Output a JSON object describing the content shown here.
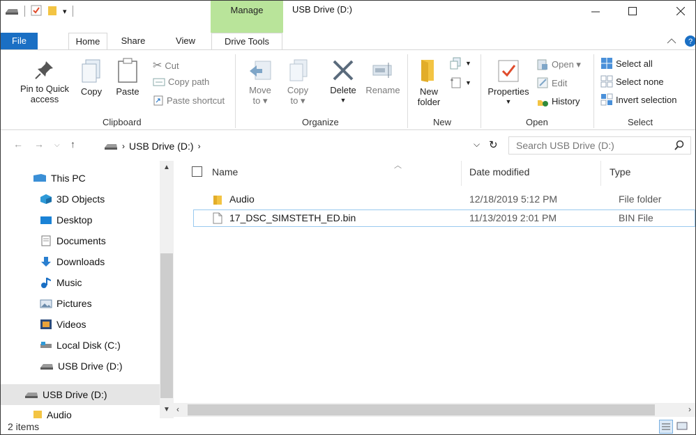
{
  "window": {
    "title": "USB Drive (D:)",
    "context_tab": "Manage"
  },
  "tabs": {
    "file": "File",
    "home": "Home",
    "share": "Share",
    "view": "View",
    "drive_tools": "Drive Tools"
  },
  "ribbon": {
    "clipboard": {
      "label": "Clipboard",
      "pin_line1": "Pin to Quick",
      "pin_line2": "access",
      "copy": "Copy",
      "paste": "Paste",
      "cut": "Cut",
      "copy_path": "Copy path",
      "paste_shortcut": "Paste shortcut"
    },
    "organize": {
      "label": "Organize",
      "move_line1": "Move",
      "move_line2": "to ▾",
      "copy_line1": "Copy",
      "copy_line2": "to ▾",
      "delete": "Delete",
      "rename": "Rename"
    },
    "new": {
      "label": "New",
      "folder_line1": "New",
      "folder_line2": "folder"
    },
    "open": {
      "label": "Open",
      "properties": "Properties",
      "open": "Open ▾",
      "edit": "Edit",
      "history": "History"
    },
    "select": {
      "label": "Select",
      "select_all": "Select all",
      "select_none": "Select none",
      "invert": "Invert selection"
    }
  },
  "address": {
    "location": "USB Drive (D:)",
    "search_placeholder": "Search USB Drive (D:)"
  },
  "nav_pane": {
    "items": [
      {
        "label": "This PC",
        "icon": "pc-icon"
      },
      {
        "label": "3D Objects",
        "icon": "3d-objects-icon"
      },
      {
        "label": "Desktop",
        "icon": "desktop-icon"
      },
      {
        "label": "Documents",
        "icon": "documents-icon"
      },
      {
        "label": "Downloads",
        "icon": "downloads-icon"
      },
      {
        "label": "Music",
        "icon": "music-icon"
      },
      {
        "label": "Pictures",
        "icon": "pictures-icon"
      },
      {
        "label": "Videos",
        "icon": "videos-icon"
      },
      {
        "label": "Local Disk (C:)",
        "icon": "local-disk-icon"
      },
      {
        "label": "USB Drive (D:)",
        "icon": "usb-drive-icon"
      },
      {
        "label": "USB Drive (D:)",
        "icon": "usb-drive-icon"
      },
      {
        "label": "Audio",
        "icon": "folder-icon"
      }
    ]
  },
  "columns": {
    "name": "Name",
    "date": "Date modified",
    "type": "Type"
  },
  "files": [
    {
      "name": "Audio",
      "date": "12/18/2019 5:12 PM",
      "type": "File folder"
    },
    {
      "name": "17_DSC_SIMSTETH_ED.bin",
      "date": "11/13/2019 2:01 PM",
      "type": "BIN File"
    }
  ],
  "status": {
    "count": "2 items"
  },
  "colors": {
    "file_tab": "#1a6fc4",
    "manage_tab": "#b9e49a",
    "folder_yellow": "#f3c443",
    "selection_border": "#99c9ef"
  }
}
